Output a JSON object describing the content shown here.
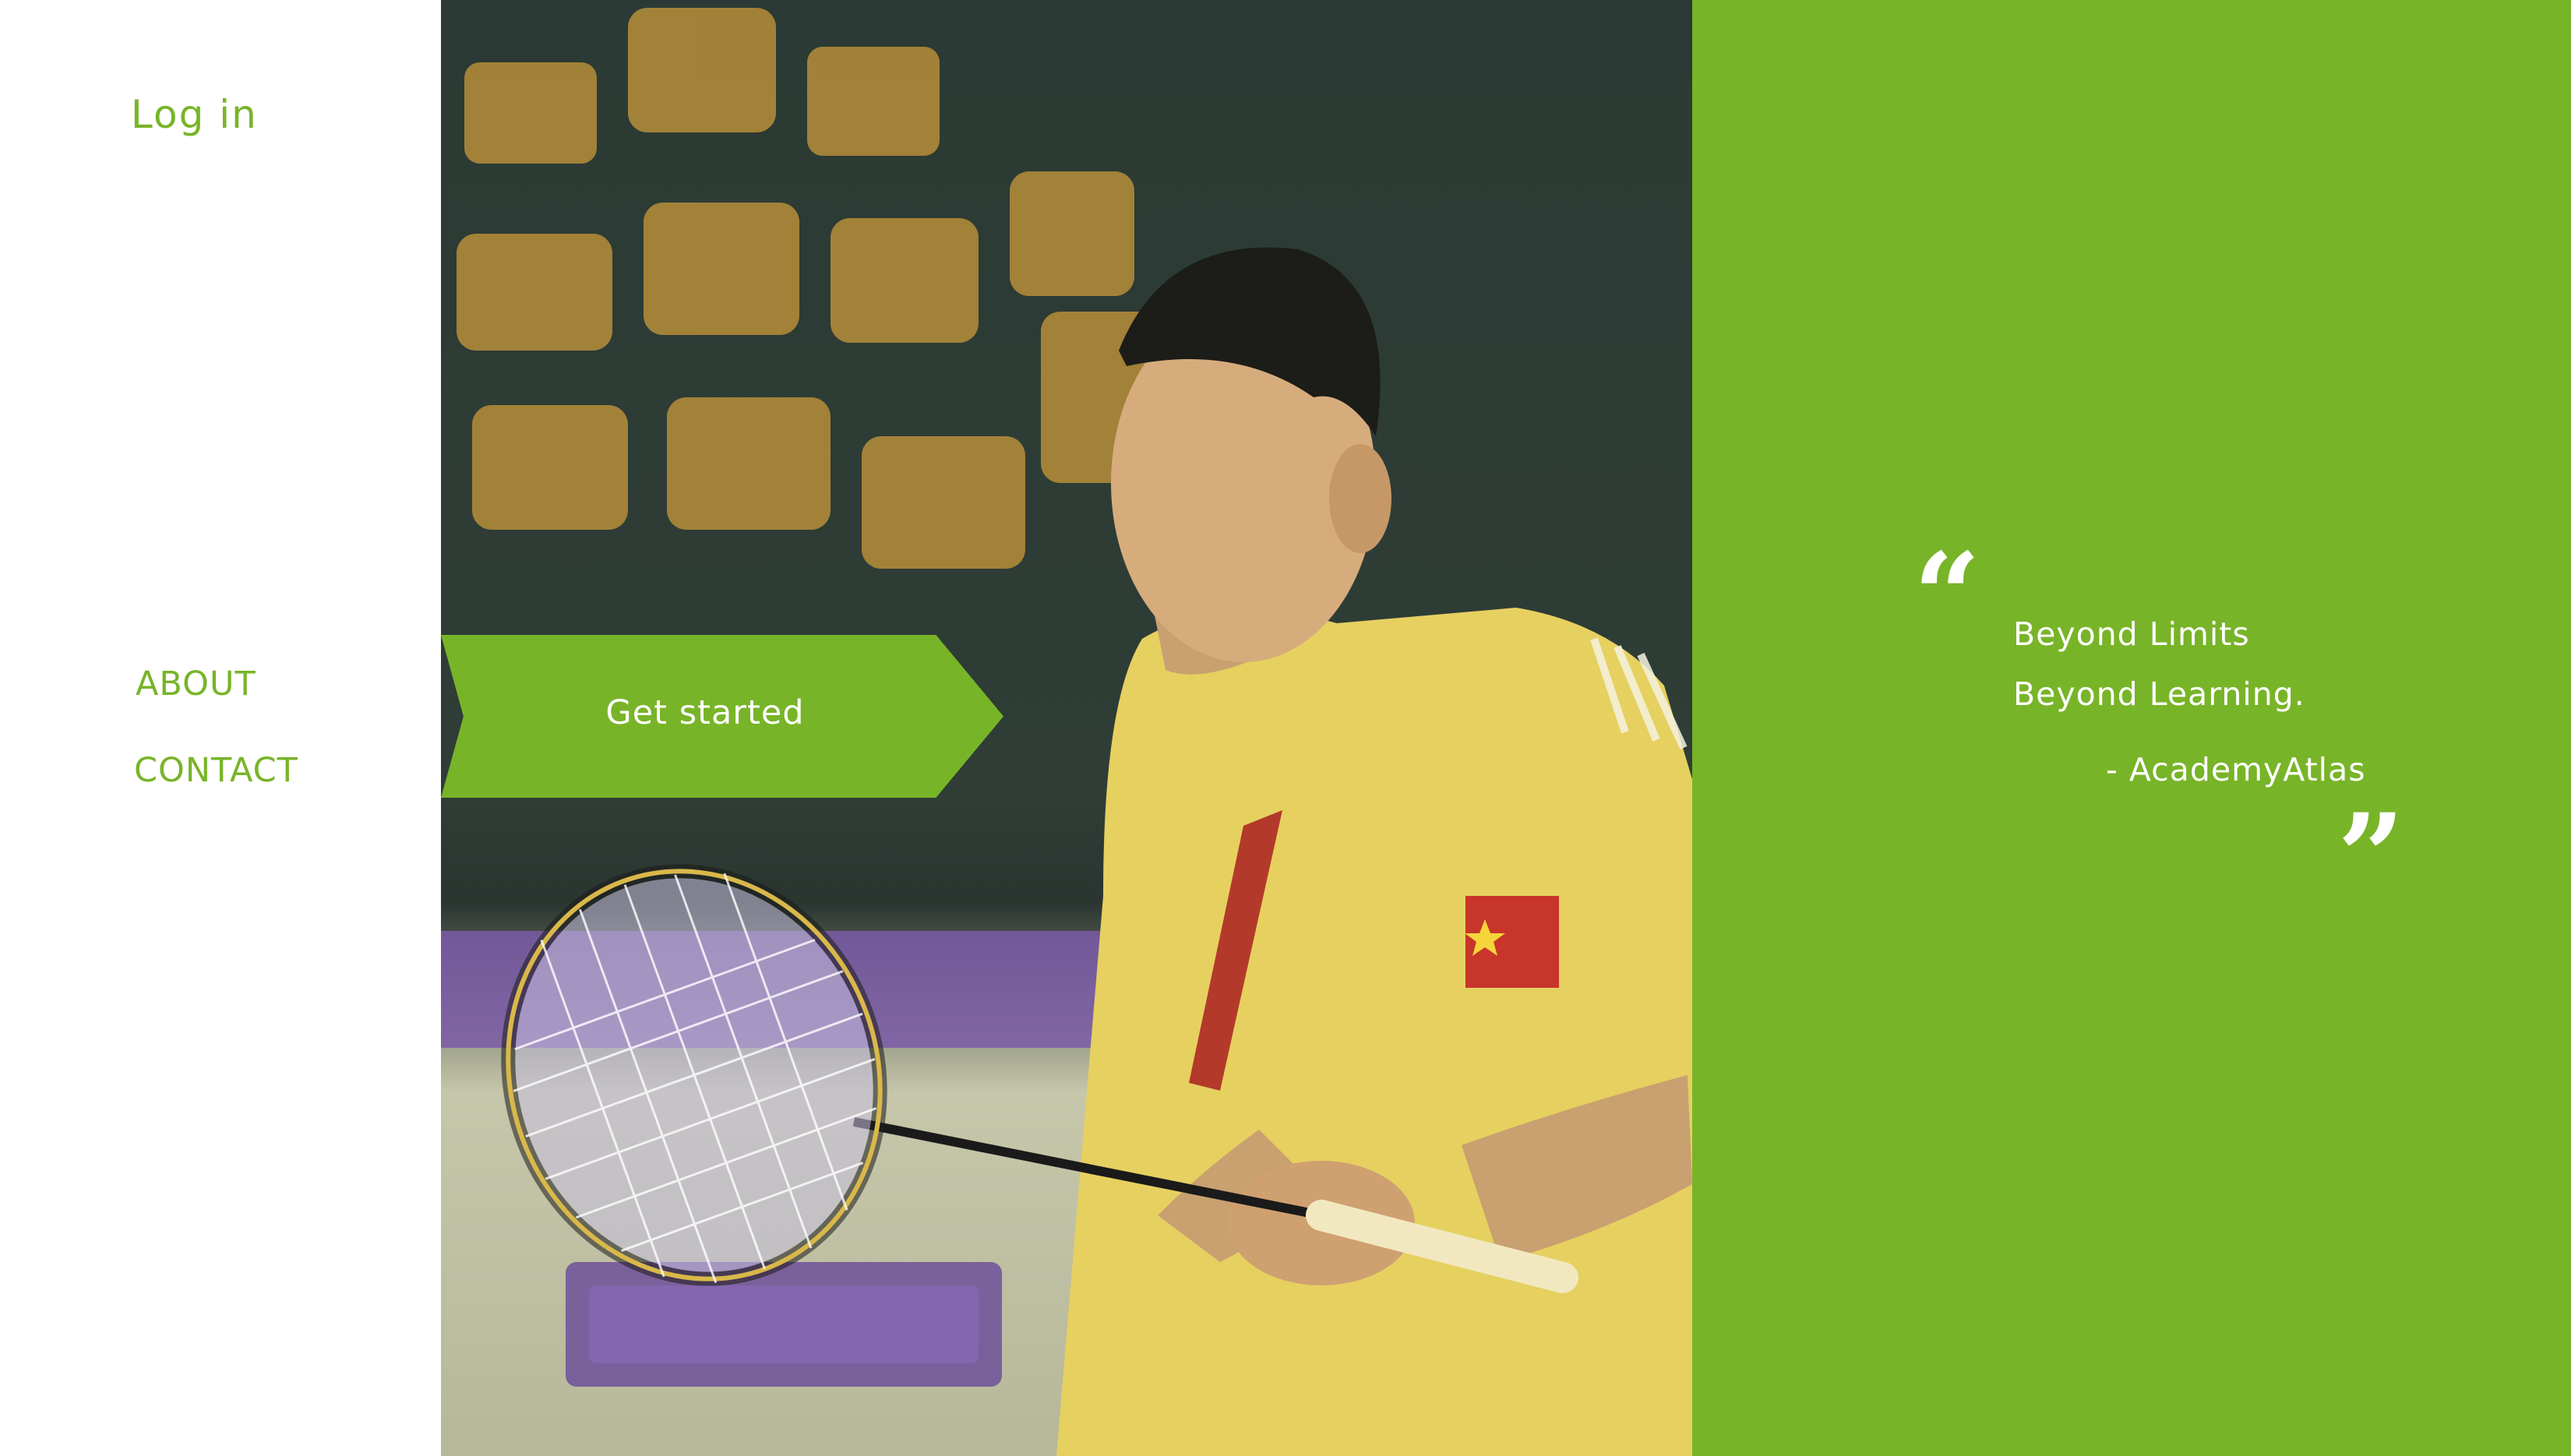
{
  "left_nav": {
    "login_label": "Log in",
    "about_label": "ABOUT",
    "contact_label": "CONTACT"
  },
  "hero": {
    "cta_label": "Get started",
    "photo_subject": "badminton player holding racket"
  },
  "quote": {
    "line1": "Beyond Limits",
    "line2": "Beyond Learning.",
    "author": "- AcademyAtlas",
    "open_mark": "“",
    "close_mark": "”"
  },
  "colors": {
    "accent": "#78b428",
    "white": "#ffffff"
  },
  "icons": {
    "open_quote": "open-quote-icon",
    "close_quote": "close-quote-icon"
  }
}
